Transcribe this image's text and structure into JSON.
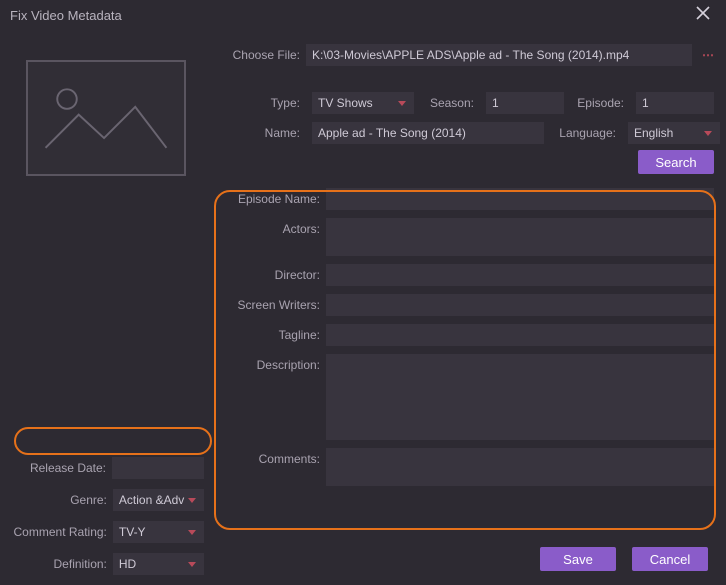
{
  "window": {
    "title": "Fix Video Metadata"
  },
  "top": {
    "choose_file_label": "Choose File:",
    "file_path": "K:\\03-Movies\\APPLE ADS\\Apple ad - The Song (2014).mp4",
    "type_label": "Type:",
    "type_value": "TV Shows",
    "season_label": "Season:",
    "season_value": "1",
    "episode_label": "Episode:",
    "episode_value": "1",
    "name_label": "Name:",
    "name_value": "Apple ad - The Song (2014)",
    "language_label": "Language:",
    "language_value": "English",
    "search_btn": "Search"
  },
  "meta": {
    "episode_name_label": "Episode Name:",
    "episode_name_value": "",
    "actors_label": "Actors:",
    "actors_value": "",
    "director_label": "Director:",
    "director_value": "",
    "screen_writers_label": "Screen Writers:",
    "screen_writers_value": "",
    "tagline_label": "Tagline:",
    "tagline_value": "",
    "description_label": "Description:",
    "description_value": "",
    "comments_label": "Comments:",
    "comments_value": ""
  },
  "left": {
    "release_date_label": "Release Date:",
    "release_date_value": "",
    "genre_label": "Genre:",
    "genre_value": "Action &Adv",
    "comment_rating_label": "Comment Rating:",
    "comment_rating_value": "TV-Y",
    "definition_label": "Definition:",
    "definition_value": "HD"
  },
  "footer": {
    "save": "Save",
    "cancel": "Cancel"
  }
}
